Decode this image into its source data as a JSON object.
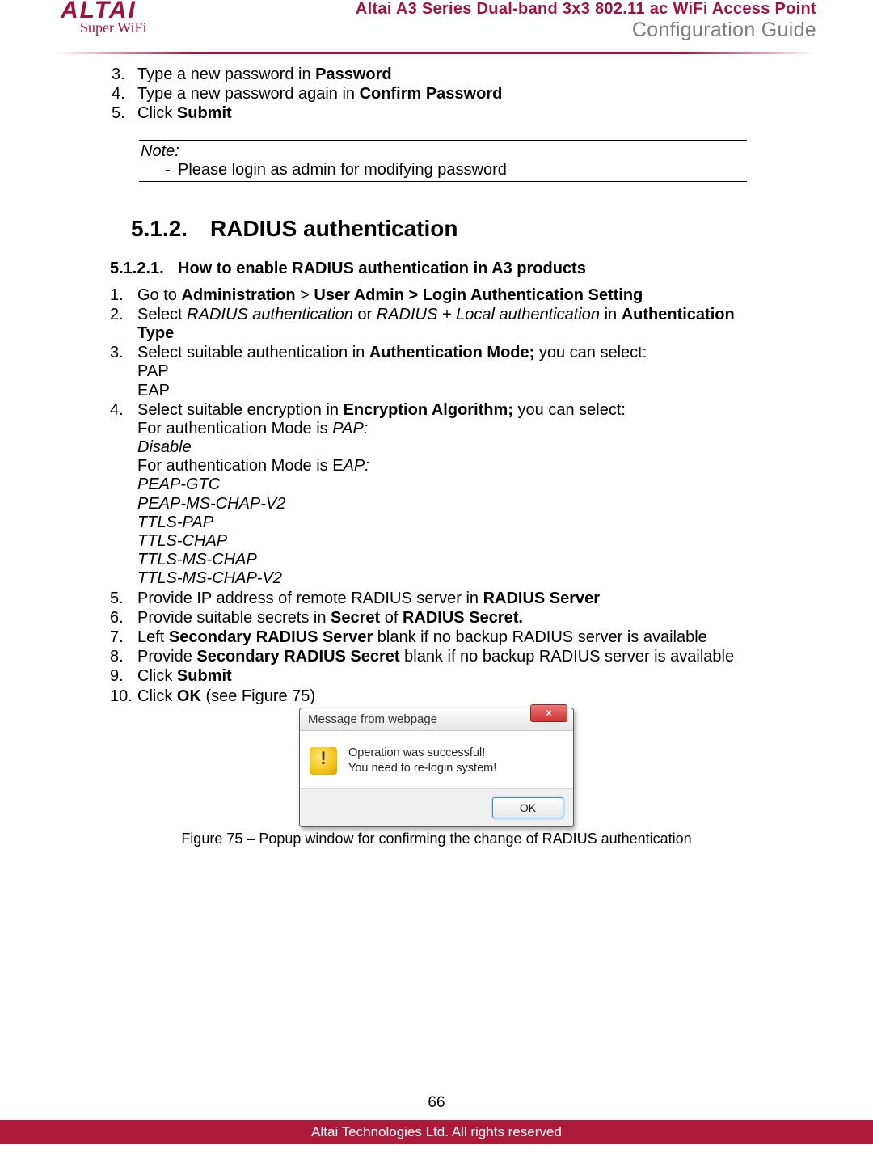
{
  "header": {
    "logo_main": "ALTAI",
    "logo_sub": "Super WiFi",
    "title": "Altai A3 Series Dual-band 3x3 802.11 ac WiFi Access Point",
    "subtitle": "Configuration Guide"
  },
  "top_steps": {
    "s3_pre": "Type a new password in ",
    "s3_b": "Password",
    "s4_pre": "Type a new password again in ",
    "s4_b": "Confirm Password",
    "s5_pre": "Click ",
    "s5_b": "Submit"
  },
  "note": {
    "label": "Note:",
    "line1": "Please login as admin for modifying password"
  },
  "h_512_num": "5.1.2.",
  "h_512_text": "RADIUS authentication",
  "h_5121_num": "5.1.2.1.",
  "h_5121_text": "How to enable RADIUS authentication in A3 products",
  "rs": {
    "s1a": "Go to ",
    "s1b": "Administration",
    "s1c": " > ",
    "s1d": "User Admin > Login Authentication Setting",
    "s2a": "Select ",
    "s2b": "RADIUS authentication",
    "s2c": " or ",
    "s2d": "RADIUS + Local authentication",
    "s2e": " in ",
    "s2f": "Authentication Type",
    "s3a": "Select suitable authentication in ",
    "s3b": "Authentication Mode;",
    "s3c": " you can select:",
    "s3_pap": "PAP",
    "s3_eap": "EAP",
    "s4a": "Select suitable encryption in ",
    "s4b": "Encryption Algorithm;",
    "s4c": " you can select:",
    "s4_l1a": "For authentication Mode is ",
    "s4_l1b": "PAP:",
    "s4_l2": "Disable",
    "s4_l3a": "For authentication Mode is E",
    "s4_l3b": "AP:",
    "s4_l4": "PEAP-GTC",
    "s4_l5": "PEAP-MS-CHAP-V2",
    "s4_l6": "TTLS-PAP",
    "s4_l7": "TTLS-CHAP",
    "s4_l8": "TTLS-MS-CHAP",
    "s4_l9": "TTLS-MS-CHAP-V2",
    "s5a": "Provide IP address of remote RADIUS server in ",
    "s5b": "RADIUS Server",
    "s6a": "Provide suitable secrets in ",
    "s6b": "Secret",
    "s6c": " of ",
    "s6d": "RADIUS Secret.",
    "s7a": "Left ",
    "s7b": "Secondary RADIUS Server",
    "s7c": " blank if no backup RADIUS server is available",
    "s8a": "Provide ",
    "s8b": "Secondary RADIUS Secret",
    "s8c": " blank if no backup RADIUS server is available",
    "s9a": "Click ",
    "s9b": "Submit",
    "s10a": "Click ",
    "s10b": "OK",
    "s10c": " (see Figure 75)"
  },
  "popup": {
    "title": "Message from webpage",
    "close": "x",
    "msg1": "Operation was successful!",
    "msg2": "You need to re-login system!",
    "ok": "OK"
  },
  "figure_caption": "Figure 75 – Popup window for confirming the change of RADIUS authentication",
  "page_number": "66",
  "footer": "Altai Technologies Ltd. All rights reserved"
}
